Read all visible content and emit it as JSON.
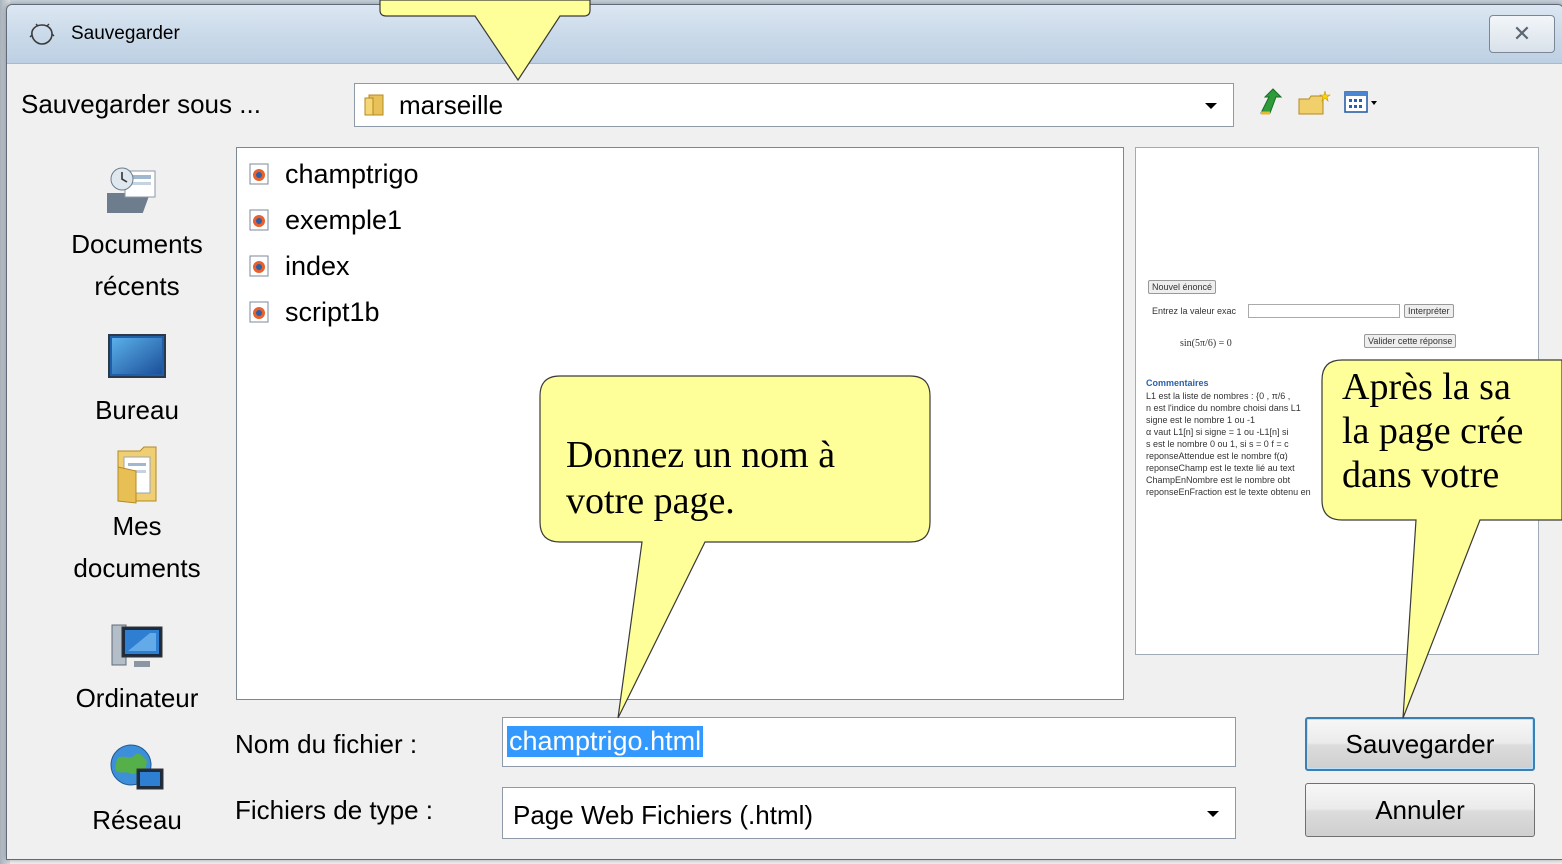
{
  "dialog": {
    "title": "Sauvegarder",
    "close_glyph": "✕"
  },
  "location": {
    "label": "Sauvegarder sous ...",
    "value": "marseille"
  },
  "toolbar": {
    "icons": [
      "up-folder-icon",
      "new-folder-icon",
      "view-menu-icon"
    ]
  },
  "places": [
    {
      "label_line1": "Documents",
      "label_line2": "récents",
      "icon": "recent-documents-icon"
    },
    {
      "label_line1": "Bureau",
      "label_line2": "",
      "icon": "desktop-icon"
    },
    {
      "label_line1": "Mes",
      "label_line2": "documents",
      "icon": "my-documents-icon"
    },
    {
      "label_line1": "Ordinateur",
      "label_line2": "",
      "icon": "computer-icon"
    },
    {
      "label_line1": "Réseau",
      "label_line2": "",
      "icon": "network-icon"
    }
  ],
  "files": [
    {
      "name": "champtrigo"
    },
    {
      "name": "exemple1"
    },
    {
      "name": "index"
    },
    {
      "name": "script1b"
    }
  ],
  "preview": {
    "button1": "Nouvel énoncé",
    "input_label": "Entrez la valeur exac",
    "button2": "Interpréter",
    "formula": "sin(5π/6) = 0",
    "button3": "Valider cette réponse",
    "comments_title": "Commentaires",
    "lines": [
      "L1 est la liste de nombres : {0 , π/6 ,",
      "n est l'indice du nombre choisi dans L1",
      "signe est le nombre 1 ou -1",
      "α vaut L1[n] si signe = 1 ou -L1[n] si",
      "s est le nombre 0 ou 1, si s = 0  f = c",
      "reponseAttendue est le nombre f(α)",
      "reponseChamp est le texte lié au text",
      "ChampEnNombre  est le nombre obt",
      "reponseEnFraction est le texte obtenu en"
    ]
  },
  "filename": {
    "label": "Nom du fichier :",
    "value": "champtrigo.html"
  },
  "filetype": {
    "label": "Fichiers de type :",
    "value": "Page Web Fichiers (.html)"
  },
  "buttons": {
    "save": "Sauvegarder",
    "cancel": "Annuler"
  },
  "callouts": {
    "name_line1": "Donnez un nom à",
    "name_line2": "votre page.",
    "after_line1": "Après la sa",
    "after_line2": "la page crée",
    "after_line3": "dans votre"
  },
  "colors": {
    "callout_fill": "#ffff99",
    "selection": "#3399ff",
    "default_button_border": "#3c7fb1"
  }
}
